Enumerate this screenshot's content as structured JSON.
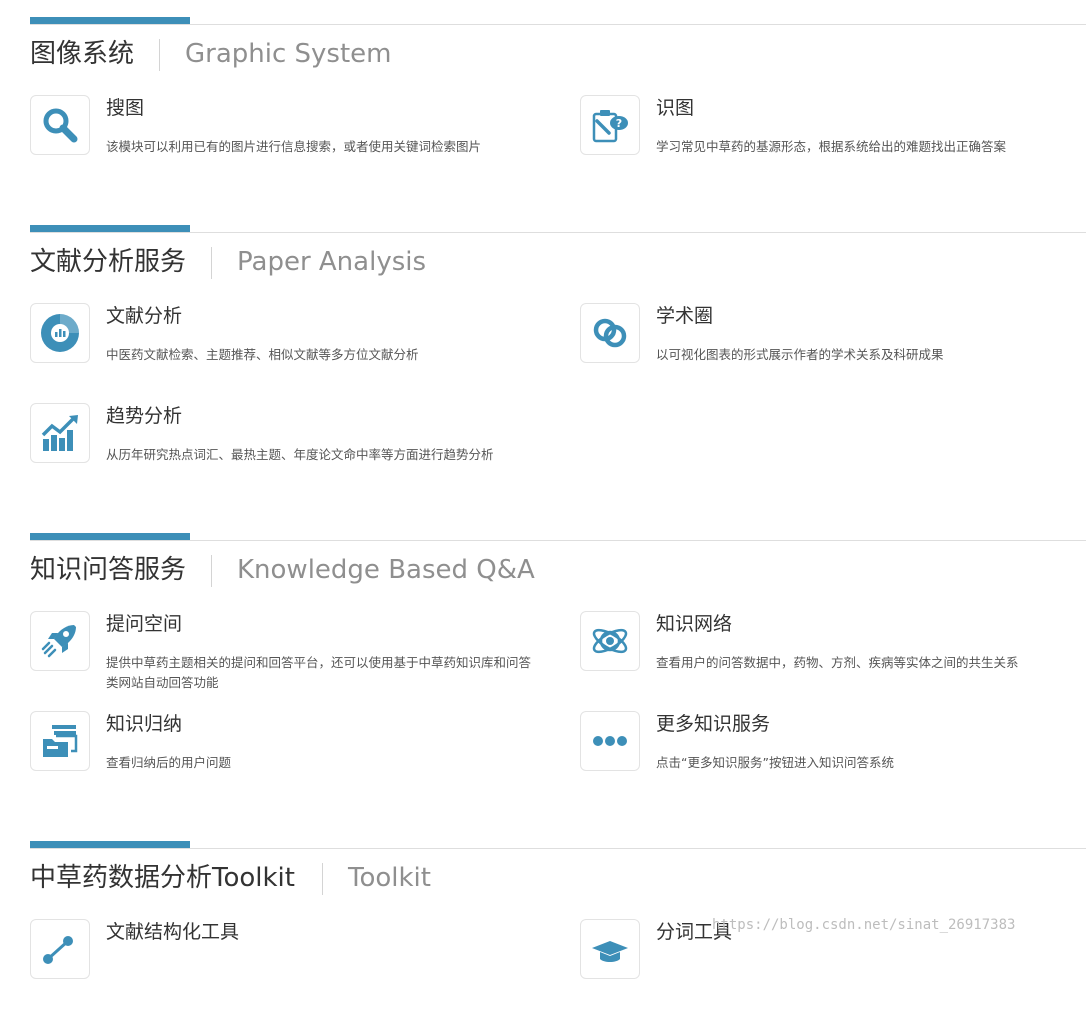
{
  "colors": {
    "accent": "#3d8fb8",
    "title": "#333333",
    "subtitle": "#8f8f8f",
    "desc": "#555555"
  },
  "sections": [
    {
      "title": "图像系统",
      "subtitle": "Graphic System",
      "cards": [
        {
          "title": "搜图",
          "desc": "该模块可以利用已有的图片进行信息搜索，或者使用关键词检索图片",
          "icon": "search-icon"
        },
        {
          "title": "识图",
          "desc": "学习常见中草药的基源形态，根据系统给出的难题找出正确答案",
          "icon": "clipboard-question-icon"
        }
      ]
    },
    {
      "title": "文献分析服务",
      "subtitle": "Paper Analysis",
      "cards": [
        {
          "title": "文献分析",
          "desc": "中医药文献检索、主题推荐、相似文献等多方位文献分析",
          "icon": "pie-chart-icon"
        },
        {
          "title": "学术圈",
          "desc": "以可视化图表的形式展示作者的学术关系及科研成果",
          "icon": "linked-rings-icon"
        },
        {
          "title": "趋势分析",
          "desc": "从历年研究热点词汇、最热主题、年度论文命中率等方面进行趋势分析",
          "icon": "trend-chart-icon"
        }
      ]
    },
    {
      "title": "知识问答服务",
      "subtitle": "Knowledge Based Q&A",
      "cards": [
        {
          "title": "提问空间",
          "desc": "提供中草药主题相关的提问和回答平台，还可以使用基于中草药知识库和问答类网站自动回答功能",
          "icon": "rocket-icon"
        },
        {
          "title": "知识网络",
          "desc": "查看用户的问答数据中，药物、方剂、疾病等实体之间的共生关系",
          "icon": "atom-icon"
        },
        {
          "title": "知识归纳",
          "desc": "查看归纳后的用户问题",
          "icon": "folder-stack-icon"
        },
        {
          "title": "更多知识服务",
          "desc": "点击“更多知识服务”按钮进入知识问答系统",
          "icon": "more-dots-icon"
        }
      ]
    },
    {
      "title": "中草药数据分析Toolkit",
      "subtitle": "Toolkit",
      "cards": [
        {
          "title": "文献结构化工具",
          "desc": "",
          "icon": "structure-nodes-icon"
        },
        {
          "title": "分词工具",
          "desc": "",
          "icon": "graduation-cap-icon"
        }
      ]
    }
  ],
  "watermark": "https://blog.csdn.net/sinat_26917383"
}
